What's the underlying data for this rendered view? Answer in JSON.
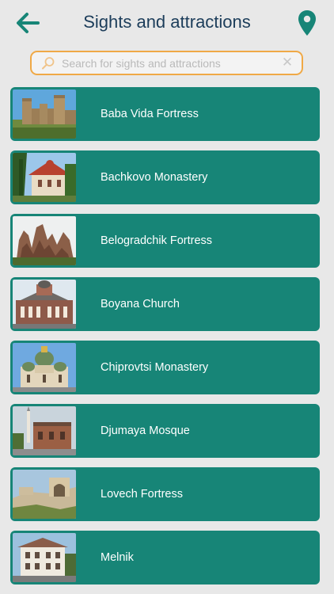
{
  "header": {
    "title": "Sights and attractions",
    "back_icon": "arrow-left-icon",
    "map_icon": "map-pin-icon",
    "accent_color": "#178577"
  },
  "search": {
    "placeholder": "Search for sights and attractions",
    "value": "",
    "search_icon": "magnifier-icon",
    "clear_icon": "close-icon",
    "border_color": "#f0a946"
  },
  "items": [
    {
      "label": "Baba Vida Fortress"
    },
    {
      "label": "Bachkovo Monastery"
    },
    {
      "label": "Belogradchik Fortress"
    },
    {
      "label": "Boyana Church"
    },
    {
      "label": "Chiprovtsi Monastery"
    },
    {
      "label": "Djumaya Mosque"
    },
    {
      "label": "Lovech Fortress"
    },
    {
      "label": "Melnik"
    }
  ]
}
